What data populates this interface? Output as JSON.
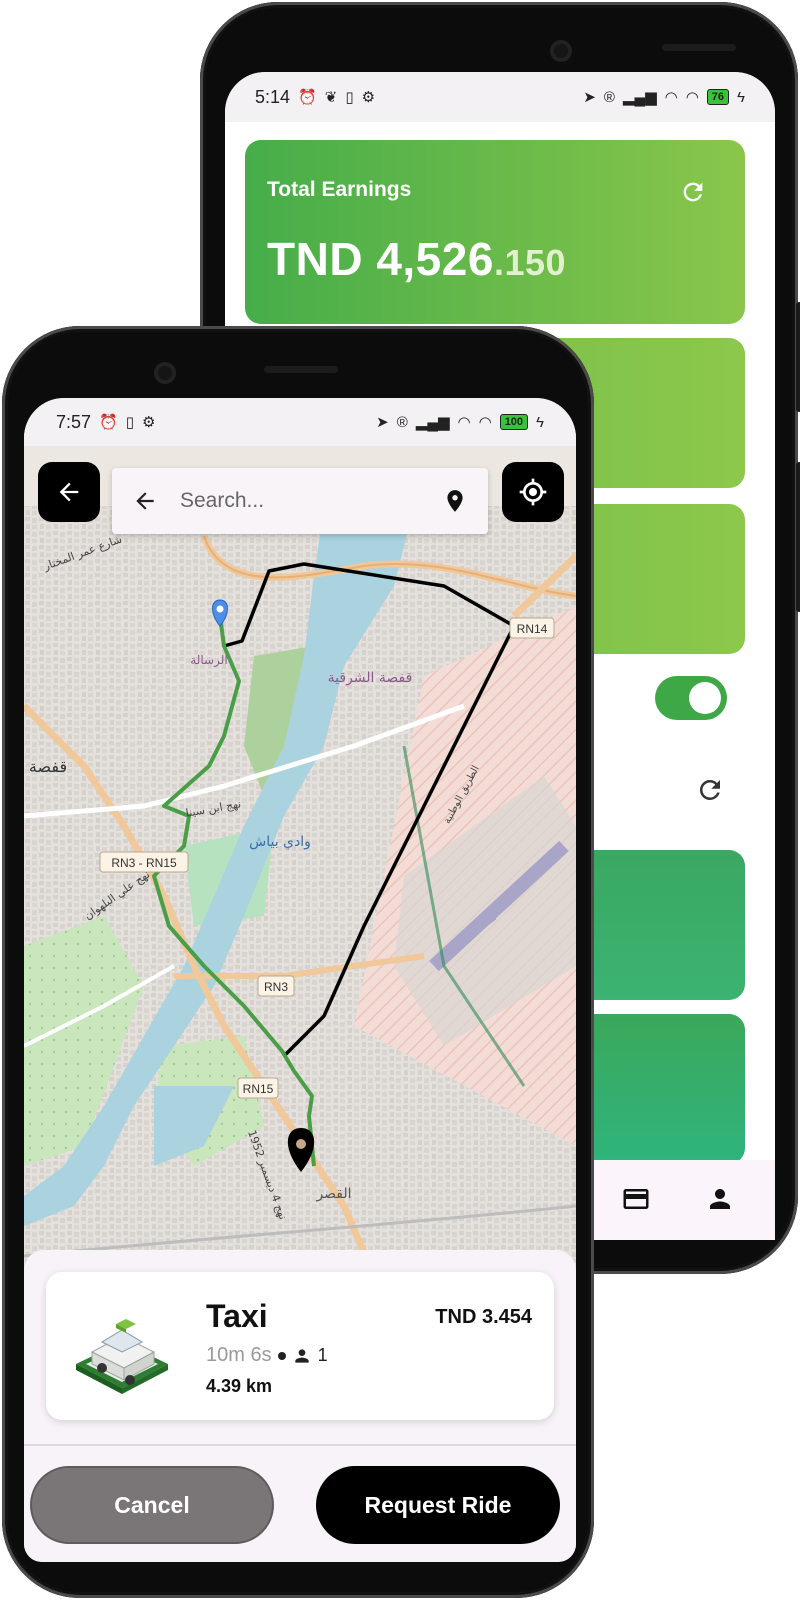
{
  "back_phone": {
    "status_bar": {
      "time": "5:14",
      "battery": "76"
    },
    "earnings_card": {
      "label": "Total Earnings",
      "amount_main": "TND 4,526",
      "amount_decimal": ".150"
    },
    "toggle": {
      "state": "on"
    },
    "nav": {
      "icons": [
        "card-icon",
        "person-icon"
      ]
    }
  },
  "front_phone": {
    "status_bar": {
      "time": "7:57",
      "battery": "100"
    },
    "search": {
      "placeholder": "Search..."
    },
    "map": {
      "road_labels": [
        "RN14",
        "RN3 - RN15",
        "RN3",
        "RN15"
      ],
      "place_labels": [
        "قفصة الشرقية",
        "وادي بياش",
        "قفصة",
        "القصر",
        "الرسالة",
        "نهج ابن سينا",
        "نهج علي البلهوان",
        "شارع عمر المختار",
        "نهج 4 ديسمبر 1952",
        "الطريق الوطنية"
      ]
    },
    "ride": {
      "type": "Taxi",
      "price": "TND 3.454",
      "duration": "10m 6s",
      "passengers": "1",
      "distance": "4.39 km"
    },
    "buttons": {
      "cancel": "Cancel",
      "request": "Request Ride"
    }
  },
  "colors": {
    "earnings_gradient_start": "#46ad49",
    "earnings_gradient_end": "#8ac64b",
    "route_green": "#4a9e47",
    "route_black": "#000000",
    "water": "#aad3df"
  }
}
